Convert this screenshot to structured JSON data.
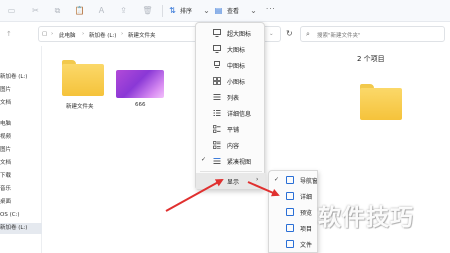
{
  "toolbar": {
    "sort_label": "排序",
    "view_label": "查看",
    "more": "···"
  },
  "address": {
    "parts": [
      "此电脑",
      "新加卷 (L:)",
      "新建文件夹"
    ],
    "refresh_icon": "refresh-icon"
  },
  "search": {
    "placeholder": "搜索\"新建文件夹\""
  },
  "sidebar": {
    "items": [
      {
        "label": "新加卷 (L:)",
        "selected": false
      },
      {
        "label": "图片",
        "selected": false
      },
      {
        "label": "文档",
        "selected": false
      },
      {
        "label": "电脑",
        "selected": false
      },
      {
        "label": "视频",
        "selected": false
      },
      {
        "label": "图片",
        "selected": false
      },
      {
        "label": "文档",
        "selected": false
      },
      {
        "label": "下载",
        "selected": false
      },
      {
        "label": "音乐",
        "selected": false
      },
      {
        "label": "桌面",
        "selected": false
      },
      {
        "label": "OS (C:)",
        "selected": false
      },
      {
        "label": "新加卷 (L:)",
        "selected": true
      }
    ]
  },
  "files": [
    {
      "name": "新建文件夹",
      "type": "folder"
    },
    {
      "name": "666",
      "type": "image"
    }
  ],
  "preview": {
    "item_count": "2 个项目"
  },
  "view_menu": {
    "items": [
      {
        "label": "超大图标",
        "checked": false
      },
      {
        "label": "大图标",
        "checked": false
      },
      {
        "label": "中图标",
        "checked": false
      },
      {
        "label": "小图标",
        "checked": false
      },
      {
        "label": "列表",
        "checked": false
      },
      {
        "label": "详细信息",
        "checked": false
      },
      {
        "label": "平铺",
        "checked": false
      },
      {
        "label": "内容",
        "checked": false
      },
      {
        "label": "紧凑视图",
        "checked": true
      },
      {
        "label": "显示",
        "checked": false,
        "has_submenu": true,
        "hovered": true
      }
    ]
  },
  "show_submenu": {
    "items": [
      {
        "label": "导航窗格",
        "checked": true
      },
      {
        "label": "详细",
        "checked": false
      },
      {
        "label": "预览",
        "checked": false
      },
      {
        "label": "项目",
        "checked": false
      },
      {
        "label": "文件",
        "checked": false
      }
    ]
  },
  "colors": {
    "accent": "#2a6fd6",
    "annotation_arrow": "#e0302f",
    "folder": "#f5c33b"
  },
  "watermark": "软件技巧"
}
